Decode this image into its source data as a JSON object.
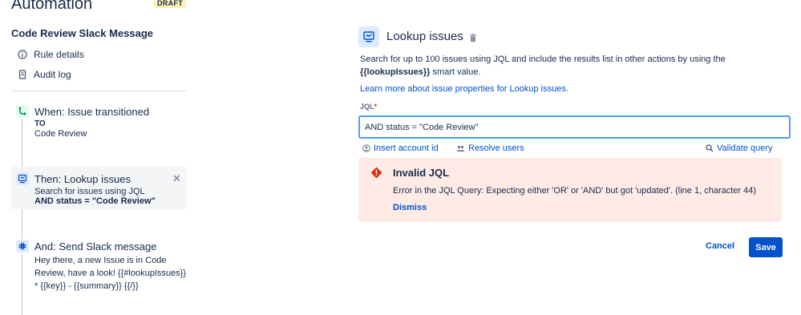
{
  "header": {
    "title": "Automation",
    "badge": "DRAFT"
  },
  "rule": {
    "name": "Code Review Slack Message"
  },
  "nav": [
    {
      "label": "Rule details",
      "icon": "info-icon"
    },
    {
      "label": "Audit log",
      "icon": "document-icon"
    }
  ],
  "steps": {
    "when": {
      "title": "When: Issue transitioned",
      "line1": "TO",
      "line2": "Code Review",
      "icon": "transition-icon"
    },
    "then": {
      "title": "Then: Lookup issues",
      "line1": "Search for issues using JQL",
      "line2": "AND status = \"Code Review\"",
      "icon": "lookup-issues-icon"
    },
    "and": {
      "title": "And: Send Slack message",
      "line1": "Hey there, a new Issue is in Code",
      "line2": "Review, have a look! {{#lookupIssues}}",
      "line3": "* {{key}} - {{summary}} {{/}}",
      "icon": "slack-icon"
    }
  },
  "panel": {
    "title": "Lookup issues",
    "desc_part1": "Search for up to 100 issues using JQL and include the results list in other actions by using the",
    "desc_smart": "{{lookupIssues}}",
    "desc_part2": " smart value.",
    "learn_more": "Learn more about issue properties for Lookup issues.",
    "jql_label": "JQL",
    "jql_required": "*",
    "jql_value": "AND status = \"Code Review\"",
    "insert_account": "Insert account id",
    "resolve_users": "Resolve users",
    "validate": "Validate query"
  },
  "error": {
    "title": "Invalid JQL",
    "message": "Error in the JQL Query: Expecting either 'OR' or 'AND' but got 'updated'. (line 1, character 44)",
    "dismiss": "Dismiss"
  },
  "actions": {
    "cancel": "Cancel",
    "save": "Save"
  },
  "colors": {
    "accent": "#0052cc",
    "error_bg": "#ffebe6",
    "error_icon": "#de350b",
    "badge_bg": "#fff0b3"
  }
}
